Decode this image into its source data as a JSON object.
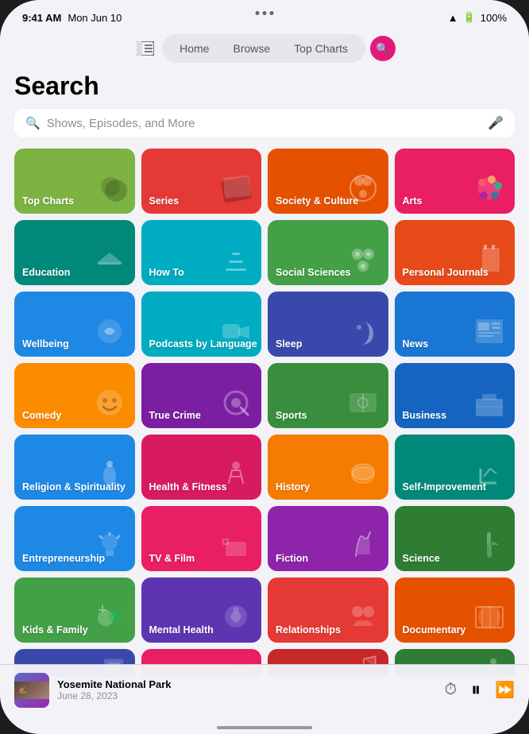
{
  "statusBar": {
    "time": "9:41 AM",
    "date": "Mon Jun 10",
    "wifi": "100%"
  },
  "nav": {
    "sidebarIcon": "⊡",
    "tabs": [
      {
        "label": "Home",
        "active": false
      },
      {
        "label": "Browse",
        "active": false
      },
      {
        "label": "Top Charts",
        "active": false
      }
    ],
    "searchActive": true
  },
  "page": {
    "title": "Search",
    "searchPlaceholder": "Shows, Episodes, and More"
  },
  "categories": [
    {
      "label": "Top Charts",
      "bg": "#7cb342",
      "icon": "🔴"
    },
    {
      "label": "Series",
      "bg": "#e53935",
      "icon": "🎬"
    },
    {
      "label": "Society & Culture",
      "bg": "#e65100",
      "icon": "🌐"
    },
    {
      "label": "Arts",
      "bg": "#e91e63",
      "icon": "🎨"
    },
    {
      "label": "Education",
      "bg": "#00897b",
      "icon": "🎓"
    },
    {
      "label": "How To",
      "bg": "#00acc1",
      "icon": "🪜"
    },
    {
      "label": "Social Sciences",
      "bg": "#43a047",
      "icon": "👥"
    },
    {
      "label": "Personal Journals",
      "bg": "#e64a19",
      "icon": "📔"
    },
    {
      "label": "Wellbeing",
      "bg": "#1e88e5",
      "icon": "🌸"
    },
    {
      "label": "Podcasts by Language",
      "bg": "#00acc1",
      "icon": "💬"
    },
    {
      "label": "Sleep",
      "bg": "#3949ab",
      "icon": "🌙"
    },
    {
      "label": "News",
      "bg": "#1976d2",
      "icon": "📰"
    },
    {
      "label": "Comedy",
      "bg": "#fb8c00",
      "icon": "😂"
    },
    {
      "label": "True Crime",
      "bg": "#7b1fa2",
      "icon": "🔍"
    },
    {
      "label": "Sports",
      "bg": "#388e3c",
      "icon": "⚽"
    },
    {
      "label": "Business",
      "bg": "#1565c0",
      "icon": "💼"
    },
    {
      "label": "Religion & Spirituality",
      "bg": "#1e88e5",
      "icon": "🕊️"
    },
    {
      "label": "Health & Fitness",
      "bg": "#d81b60",
      "icon": "🏃"
    },
    {
      "label": "History",
      "bg": "#f57c00",
      "icon": "🏺"
    },
    {
      "label": "Self-Improvement",
      "bg": "#00897b",
      "icon": "🪜"
    },
    {
      "label": "Entrepreneurship",
      "bg": "#1e88e5",
      "icon": "💡"
    },
    {
      "label": "TV & Film",
      "bg": "#e91e63",
      "icon": "🍿"
    },
    {
      "label": "Fiction",
      "bg": "#8e24aa",
      "icon": "✒️"
    },
    {
      "label": "Science",
      "bg": "#2e7d32",
      "icon": "🔬"
    },
    {
      "label": "Kids & Family",
      "bg": "#43a047",
      "icon": "🎈"
    },
    {
      "label": "Mental Health",
      "bg": "#5e35b1",
      "icon": "🧠"
    },
    {
      "label": "Relationships",
      "bg": "#e53935",
      "icon": "🤝"
    },
    {
      "label": "Documentary",
      "bg": "#e65100",
      "icon": "🎥"
    },
    {
      "label": "",
      "bg": "#3949ab",
      "icon": "💻"
    },
    {
      "label": "",
      "bg": "#e91e63",
      "icon": "🎊"
    },
    {
      "label": "",
      "bg": "#c62828",
      "icon": "🎵"
    },
    {
      "label": "",
      "bg": "#2e7d32",
      "icon": "🚶"
    }
  ],
  "player": {
    "title": "Yosemite National Park",
    "subtitle": "June 28, 2023",
    "thumbBg1": "#5c4033",
    "thumbBg2": "#8d6e63"
  },
  "icons": {
    "search": "🔍",
    "mic": "🎤",
    "timer": "⏱",
    "pause": "⏸",
    "forward30": "⏩"
  }
}
